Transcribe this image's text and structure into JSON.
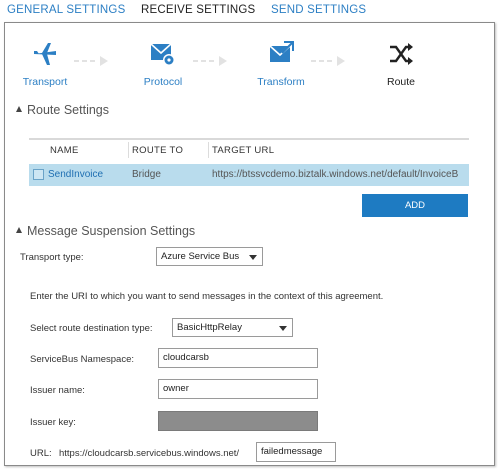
{
  "tabs": {
    "general": "GENERAL SETTINGS",
    "receive": "RECEIVE SETTINGS",
    "send": "SEND SETTINGS"
  },
  "steps": {
    "transport": {
      "label": "Transport",
      "icon": "airplane-icon"
    },
    "protocol": {
      "label": "Protocol",
      "icon": "mail-gear-icon"
    },
    "transform": {
      "label": "Transform",
      "icon": "mail-transform-icon"
    },
    "route": {
      "label": "Route",
      "icon": "shuffle-icon"
    }
  },
  "route_settings": {
    "title": "Route Settings",
    "columns": [
      "NAME",
      "ROUTE TO",
      "TARGET URL"
    ],
    "rows": [
      {
        "name": "SendInvoice",
        "route_to": "Bridge",
        "target_url": "https://btssvcdemo.biztalk.windows.net/default/InvoiceB"
      }
    ],
    "add_label": "ADD"
  },
  "message_suspension": {
    "title": "Message Suspension Settings",
    "transport_type_label": "Transport type:",
    "transport_type_value": "Azure Service Bus",
    "info_text": "Enter the URI to which you want to send messages in the context of this agreement.",
    "route_dest_label": "Select route destination type:",
    "route_dest_value": "BasicHttpRelay",
    "namespace_label": "ServiceBus Namespace:",
    "namespace_value": "cloudcarsb",
    "issuer_name_label": "Issuer name:",
    "issuer_name_value": "owner",
    "issuer_key_label": "Issuer key:",
    "url_label": "URL:",
    "url_prefix": "https://cloudcarsb.servicebus.windows.net/",
    "url_suffix_value": "failedmessage"
  },
  "colors": {
    "accent": "#2c7fc4",
    "selected_row": "#b9dced",
    "add_button": "#1e7bc2"
  }
}
